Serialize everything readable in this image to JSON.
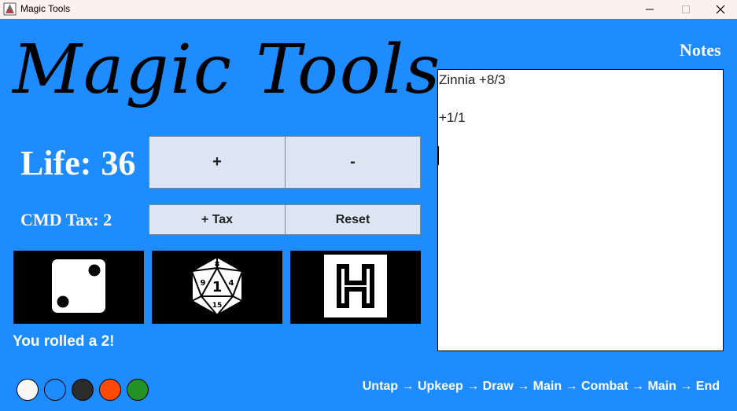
{
  "window": {
    "title": "Magic Tools",
    "icon": "magic-tools-app-icon"
  },
  "header": {
    "title": "Magic Tools"
  },
  "life": {
    "label": "Life:",
    "value": "36",
    "increment_label": "+",
    "decrement_label": "-"
  },
  "tax": {
    "label": "CMD Tax:",
    "value": "2",
    "add_label": "+ Tax",
    "reset_label": "Reset"
  },
  "tools": [
    {
      "name": "six-sided-die",
      "icon": "die-face-two-icon"
    },
    {
      "name": "twenty-sided-die",
      "icon": "d20-icon",
      "faces": [
        "8",
        "9",
        "1",
        "4",
        "15"
      ]
    },
    {
      "name": "coin-flip",
      "icon": "heads-coin-icon",
      "face": "H"
    }
  ],
  "roll": {
    "result": "You rolled a 2!"
  },
  "mana_colors": [
    {
      "name": "white",
      "color": "#f7f7f2"
    },
    {
      "name": "blue",
      "color": "#1e8bff"
    },
    {
      "name": "black",
      "color": "#2b2b2b"
    },
    {
      "name": "red",
      "color": "#ff4a0a"
    },
    {
      "name": "green",
      "color": "#249126"
    }
  ],
  "notes": {
    "label": "Notes",
    "content": "Zinnia +8/3\n\n+1/1\n"
  },
  "phases": {
    "text": "Untap → Upkeep → Draw → Main → Combat → Main → End"
  },
  "colors": {
    "background": "#1e8bff",
    "button": "#dce6f2",
    "titlebar": "#fbf1ef"
  }
}
